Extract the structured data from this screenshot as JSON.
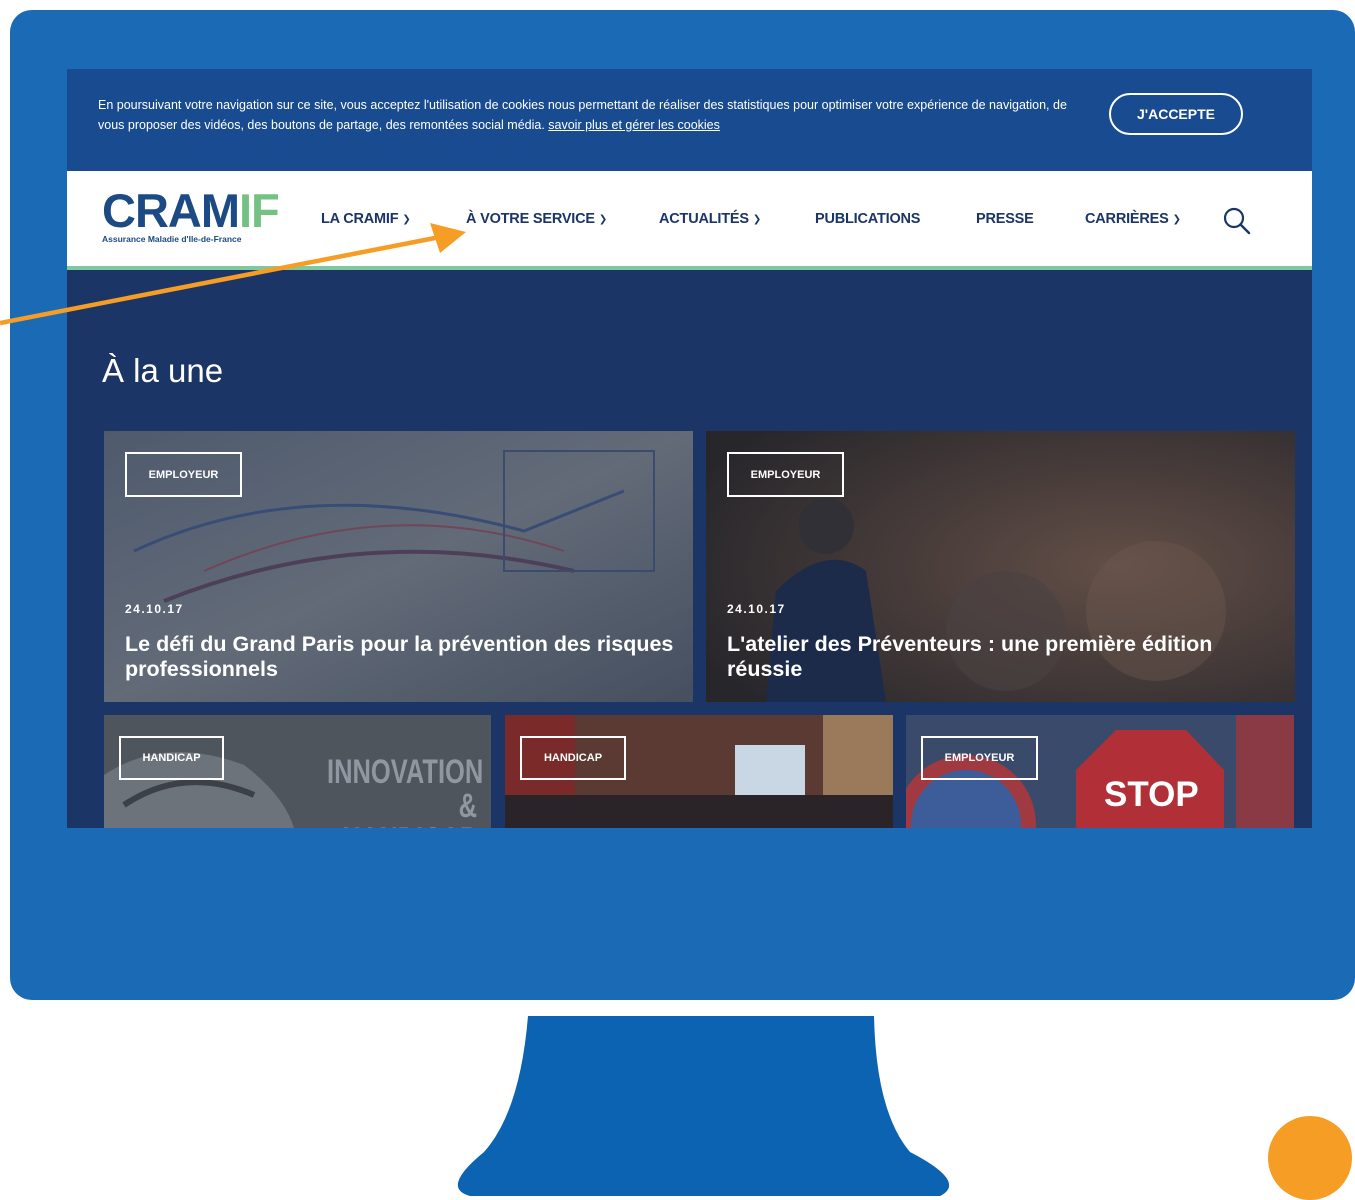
{
  "colors": {
    "monitor": "#1a6ab6",
    "screen_bg": "#1b3566",
    "cookie_bar": "#184b8f",
    "brand_blue": "#1b4a84",
    "brand_green": "#74c283",
    "arrow": "#f59d25"
  },
  "cookie_bar": {
    "message": "En poursuivant votre navigation sur ce site, vous acceptez l'utilisation de cookies nous permettant de réaliser des statistiques pour optimiser votre expérience de navigation, de vous proposer des vidéos, des boutons de partage, des remontées social média.",
    "link_label": "savoir plus et gérer les cookies",
    "accept_label": "J'ACCEPTE"
  },
  "logo": {
    "part1": "CRAM",
    "part2": "IF",
    "subtitle": "Assurance Maladie d'Ile-de-France"
  },
  "nav": {
    "items": [
      {
        "label": "LA CRAMIF",
        "has_dropdown": true
      },
      {
        "label": "À VOTRE SERVICE",
        "has_dropdown": true
      },
      {
        "label": "ACTUALITÉS",
        "has_dropdown": true
      },
      {
        "label": "PUBLICATIONS",
        "has_dropdown": false
      },
      {
        "label": "PRESSE",
        "has_dropdown": false
      },
      {
        "label": "CARRIÈRES",
        "has_dropdown": true
      }
    ],
    "search_icon": "search-icon"
  },
  "main": {
    "section_title": "À la une",
    "featured": [
      {
        "tag": "EMPLOYEUR",
        "date": "24.10.17",
        "title": "Le défi du Grand Paris pour la prévention des risques professionnels"
      },
      {
        "tag": "EMPLOYEUR",
        "date": "24.10.17",
        "title": "L'atelier des Préventeurs : une première édition réussie"
      }
    ],
    "secondary": [
      {
        "tag": "HANDICAP",
        "image_text": "INNOVATION & HANDICAP"
      },
      {
        "tag": "HANDICAP"
      },
      {
        "tag": "EMPLOYEUR",
        "image_text": "STOP"
      }
    ]
  }
}
